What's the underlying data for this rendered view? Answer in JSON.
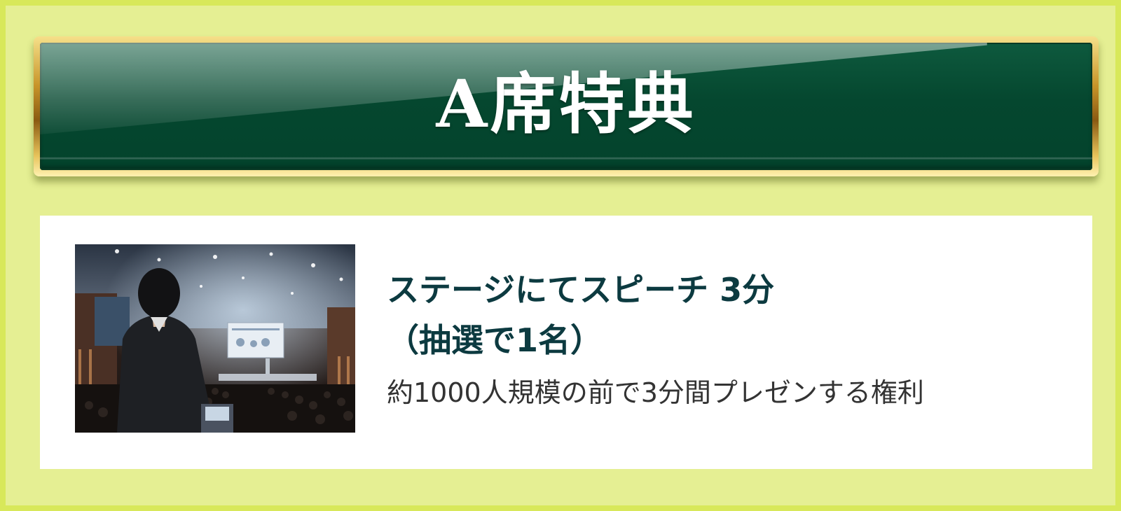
{
  "header": {
    "title": "A席特典"
  },
  "benefit": {
    "photo_icon": "stage-presentation-photo",
    "headline_line1": "ステージにてスピーチ 3分",
    "headline_line2": "（抽選で1名）",
    "description": "約1000人規模の前で3分間プレゼンする権利"
  },
  "colors": {
    "background": "#e5ef93",
    "border": "#d8e85a",
    "plate_green": "#05472f",
    "plate_gold": "#c8952a",
    "headline_text": "#0c3a40",
    "body_text": "#333333"
  }
}
